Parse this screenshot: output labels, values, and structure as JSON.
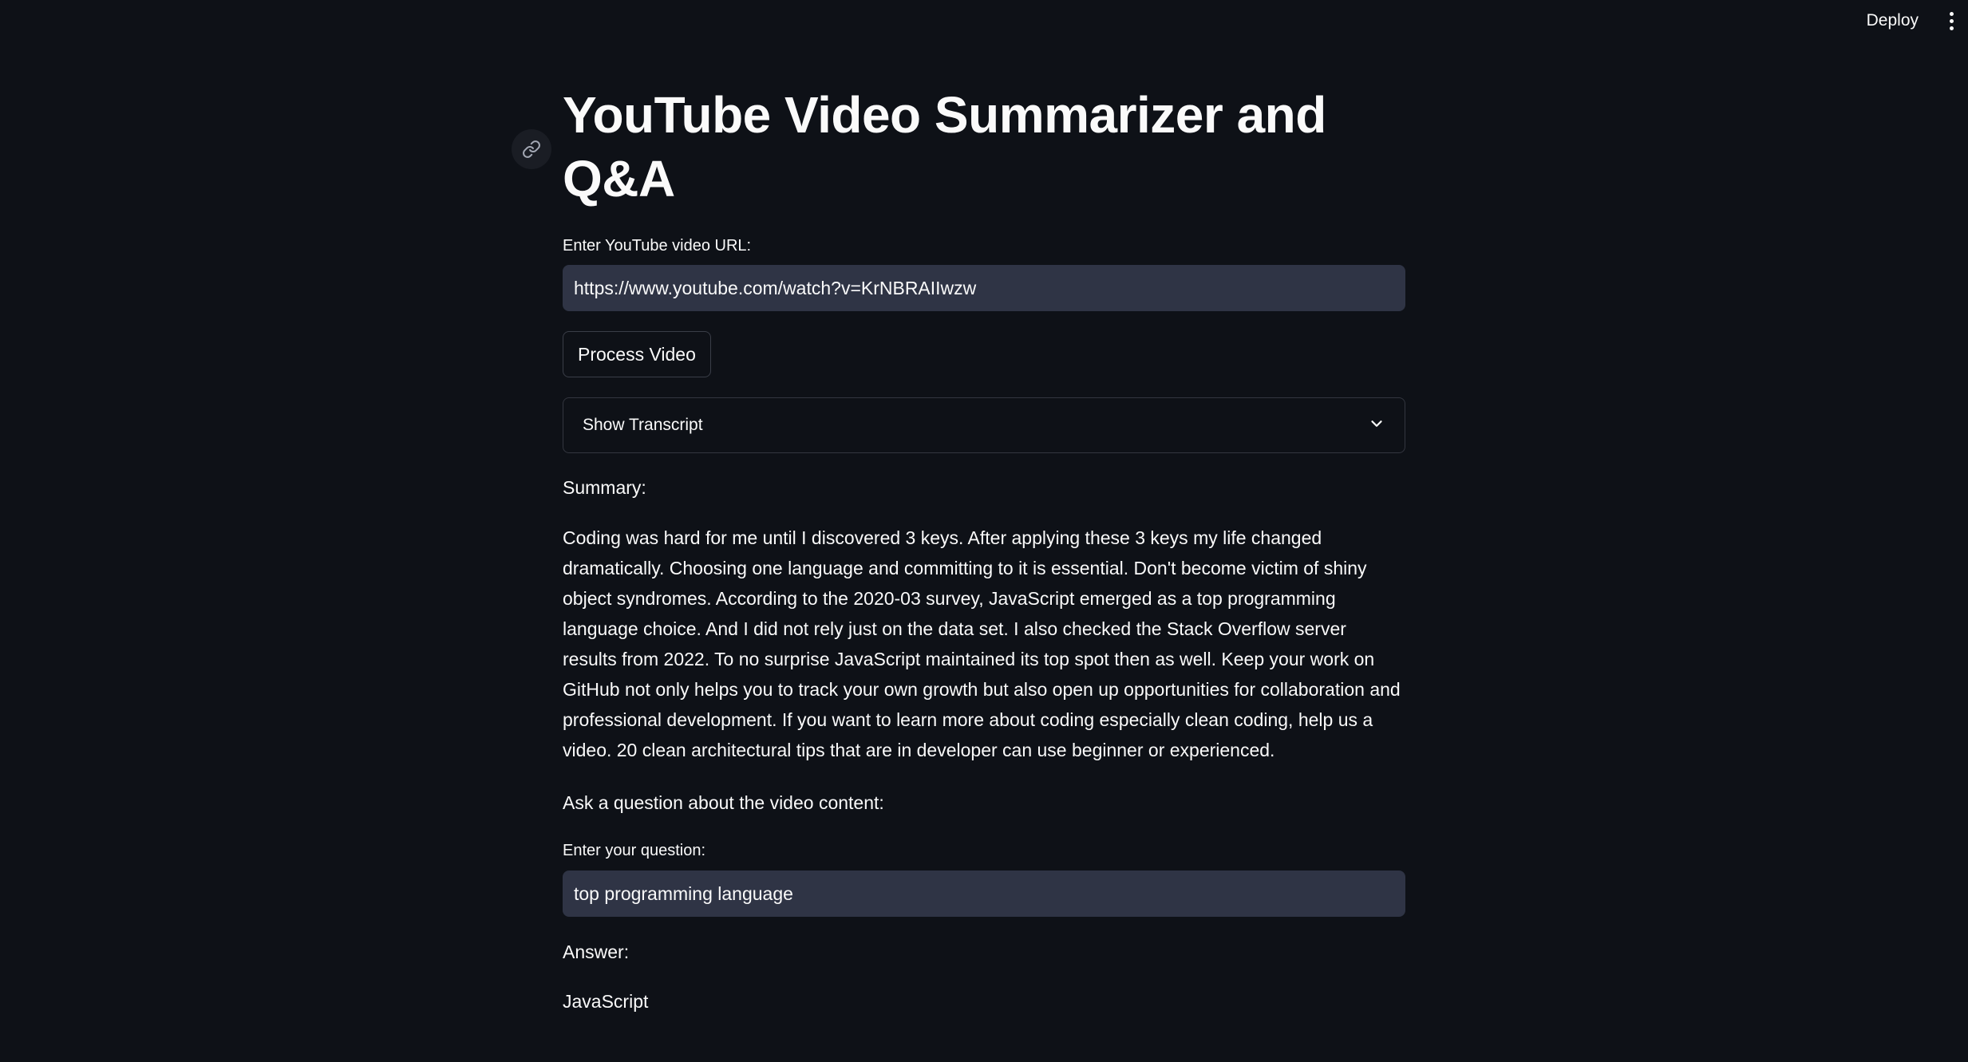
{
  "header": {
    "deploy_label": "Deploy",
    "menu_icon": "more-vertical-icon"
  },
  "main": {
    "title": "YouTube Video Summarizer and Q&A",
    "url_field": {
      "label": "Enter YouTube video URL:",
      "value": "https://www.youtube.com/watch?v=KrNBRAIIwzw"
    },
    "process_button_label": "Process Video",
    "transcript_expander": {
      "label": "Show Transcript",
      "icon": "chevron-down-icon"
    },
    "summary_heading": "Summary:",
    "summary_text": "Coding was hard for me until I discovered 3 keys. After applying these 3 keys my life changed dramatically. Choosing one language and committing to it is essential. Don't become victim of shiny object syndromes. According to the 2020-03 survey, JavaScript emerged as a top programming language choice. And I did not rely just on the data set. I also checked the Stack Overflow server results from 2022. To no surprise JavaScript maintained its top spot then as well. Keep your work on GitHub not only helps you to track your own growth but also open up opportunities for collaboration and professional development. If you want to learn more about coding especially clean coding, help us a video. 20 clean architectural tips that are in developer can use beginner or experienced.",
    "question_prompt": "Ask a question about the video content:",
    "question_field": {
      "label": "Enter your question:",
      "value": "top programming language"
    },
    "answer_heading": "Answer:",
    "answer_text": "JavaScript"
  }
}
